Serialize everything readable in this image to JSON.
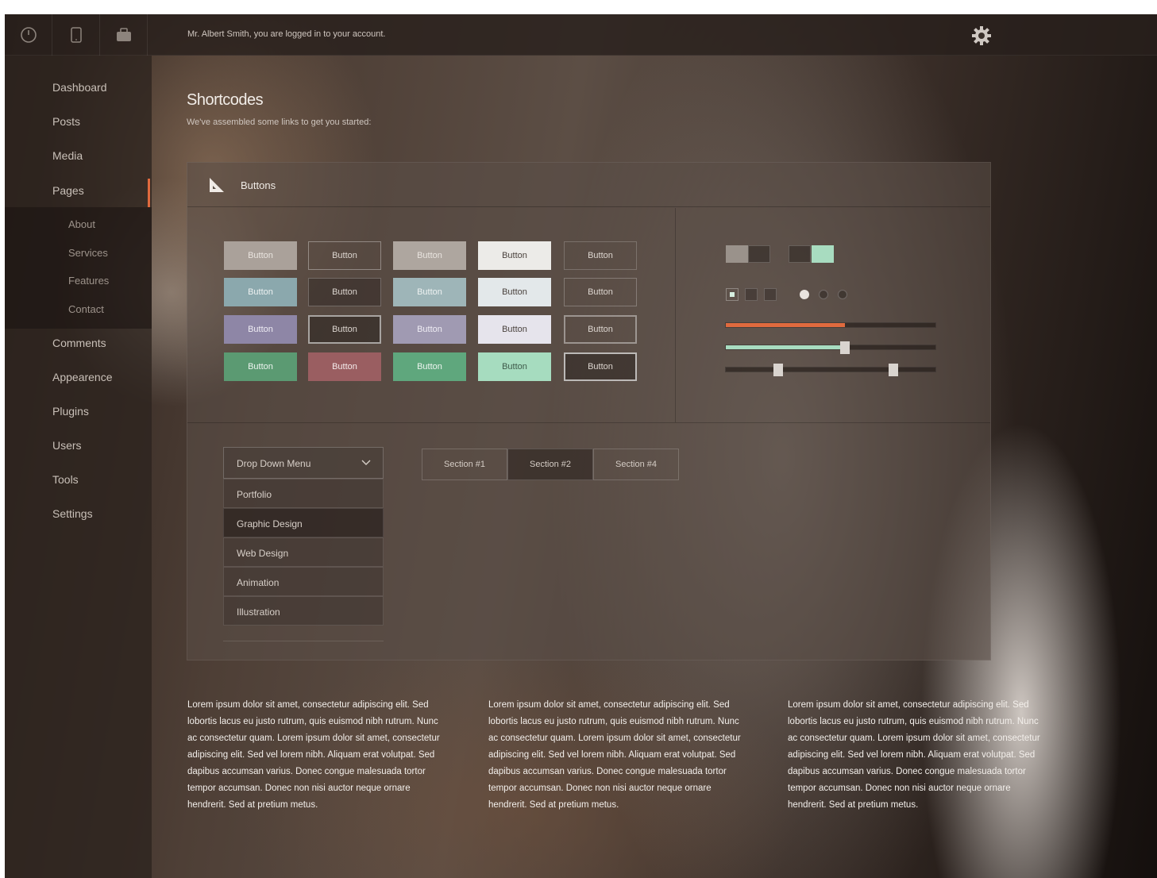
{
  "topbar": {
    "login_message": "Mr. Albert Smith, you are logged in to your account.",
    "icons": [
      "power-icon",
      "tablet-icon",
      "briefcase-icon"
    ],
    "settings_icon": "gear-icon"
  },
  "sidebar": {
    "items": [
      {
        "label": "Dashboard"
      },
      {
        "label": "Posts"
      },
      {
        "label": "Media"
      },
      {
        "label": "Pages"
      },
      {
        "label": "Comments"
      },
      {
        "label": "Appearence"
      },
      {
        "label": "Plugins"
      },
      {
        "label": "Users"
      },
      {
        "label": "Tools"
      },
      {
        "label": "Settings"
      }
    ],
    "subitems": [
      {
        "label": "About"
      },
      {
        "label": "Services"
      },
      {
        "label": "Features"
      },
      {
        "label": "Contact"
      }
    ],
    "active_item": "Pages",
    "accent_color": "#e06a3e"
  },
  "header": {
    "title": "Shortcodes",
    "subtitle": "We've assembled some links to get you started:"
  },
  "panel": {
    "title": "Buttons",
    "button_label": "Button",
    "button_rows": 4,
    "button_cols": 5
  },
  "controls": {
    "sliders": [
      {
        "color": "#e06a3e",
        "value_percent": 57
      },
      {
        "color": "#a8dcc0",
        "value_percent": 57
      },
      {
        "range": [
          25,
          80
        ]
      }
    ]
  },
  "dropdown": {
    "label": "Drop Down Menu",
    "options": [
      "Portfolio",
      "Graphic Design",
      "Web Design",
      "Animation",
      "Illustration"
    ],
    "selected": "Graphic Design"
  },
  "tabs": [
    "Section #1",
    "Section #2",
    "Section #4"
  ],
  "active_tab": "Section #2",
  "paragraphs": [
    "Lorem ipsum dolor sit amet, consectetur adipiscing elit. Sed lobortis lacus eu justo rutrum, quis euismod nibh rutrum. Nunc ac consectetur quam. Lorem ipsum dolor sit amet, consectetur adipiscing elit. Sed vel lorem nibh. Aliquam erat volutpat. Sed dapibus accumsan varius. Donec congue malesuada tortor tempor accumsan. Donec non nisi auctor neque ornare hendrerit. Sed at pretium metus.",
    "Lorem ipsum dolor sit amet, consectetur adipiscing elit. Sed lobortis lacus eu justo rutrum, quis euismod nibh rutrum. Nunc ac consectetur quam. Lorem ipsum dolor sit amet, consectetur adipiscing elit. Sed vel lorem nibh. Aliquam erat volutpat. Sed dapibus accumsan varius. Donec congue malesuada tortor tempor accumsan. Donec non nisi auctor neque ornare hendrerit. Sed at pretium metus.",
    "Lorem ipsum dolor sit amet, consectetur adipiscing elit. Sed lobortis lacus eu justo rutrum, quis euismod nibh rutrum. Nunc ac consectetur quam. Lorem ipsum dolor sit amet, consectetur adipiscing elit. Sed vel lorem nibh. Aliquam erat volutpat. Sed dapibus accumsan varius. Donec congue malesuada tortor tempor accumsan. Donec non nisi auctor neque ornare hendrerit. Sed at pretium metus."
  ]
}
